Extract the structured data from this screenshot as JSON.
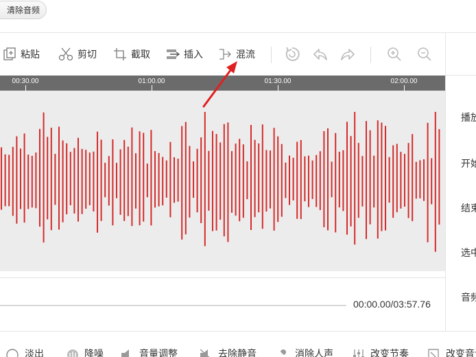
{
  "top": {
    "clear_audio_label": "清除音频"
  },
  "toolbar": {
    "paste_label": "粘贴",
    "cut_label": "剪切",
    "crop_label": "截取",
    "insert_label": "插入",
    "mix_label": "混流"
  },
  "ruler": {
    "labels": [
      "00:30.00",
      "01:00.00",
      "01:30.00",
      "02:00.00"
    ]
  },
  "waveform": {
    "color": "#d42a2a"
  },
  "right_panel": {
    "labels": [
      "播放",
      "开始",
      "结束",
      "选中",
      "音频"
    ]
  },
  "playback": {
    "time": "00:00.00/03:57.76",
    "progress": 0
  },
  "bottom": {
    "items": [
      {
        "label": "淡出"
      },
      {
        "label": "降噪"
      },
      {
        "label": "音量调整"
      },
      {
        "label": "去除静音"
      },
      {
        "label": "消除人声"
      },
      {
        "label": "改变节奏"
      },
      {
        "label": "改变音调"
      }
    ]
  },
  "colors": {
    "accent": "#e02020",
    "ruler": "#6b6b6b",
    "wave_bg": "#ececec"
  }
}
